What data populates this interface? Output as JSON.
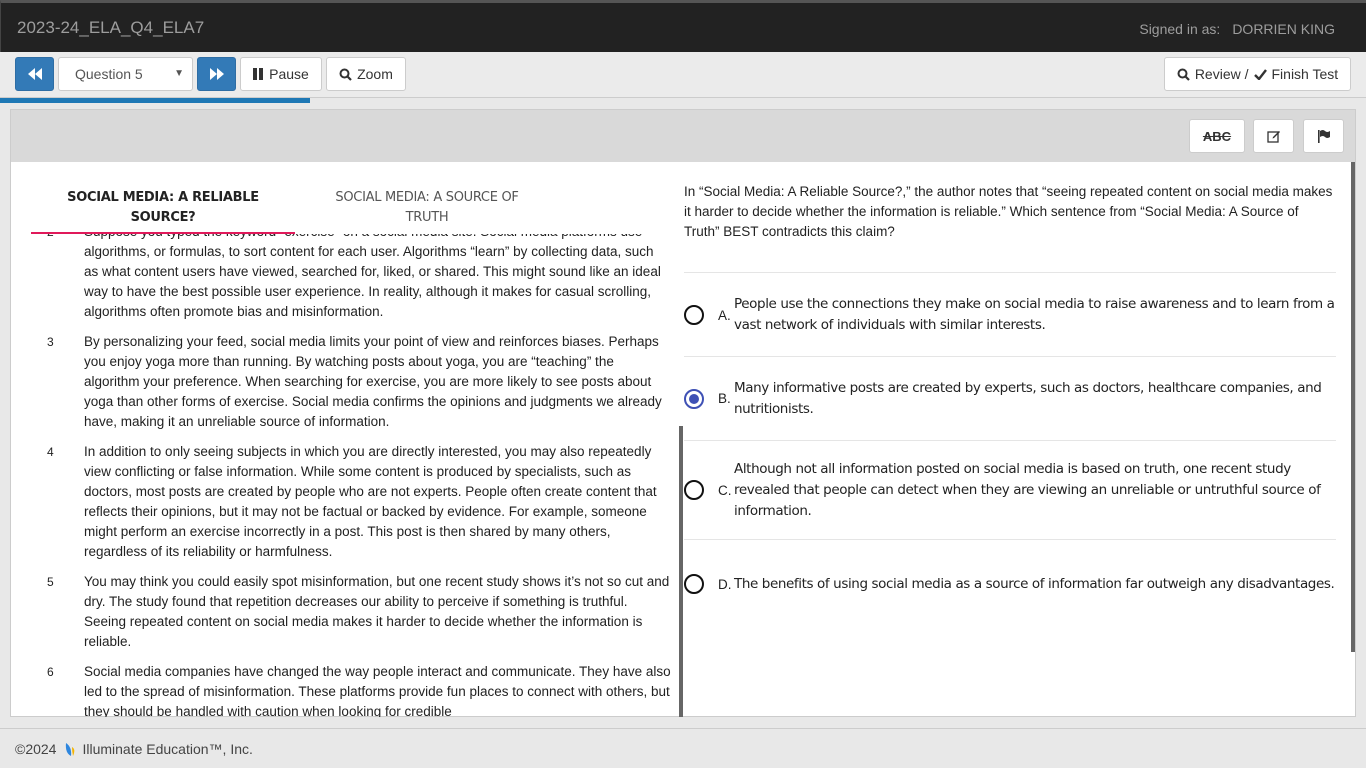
{
  "app": {
    "title": "2023-24_ELA_Q4_ELA7",
    "signed_in_label": "Signed in as:",
    "user_name": "DORRIEN KING"
  },
  "toolbar": {
    "prev_icon": "fast-backward-icon",
    "question_select": {
      "selected": "Question 5"
    },
    "next_icon": "fast-forward-icon",
    "pause_label": "Pause",
    "zoom_label": "Zoom",
    "review_label": "Review /",
    "finish_label": "Finish Test",
    "progress_percent": 22.7
  },
  "tools": {
    "strikethrough_label": "ABC",
    "notes_icon": "edit-icon",
    "flag_icon": "flag-icon"
  },
  "passage": {
    "tabs": [
      {
        "label": "SOCIAL MEDIA: A RELIABLE SOURCE?",
        "active": true
      },
      {
        "label": "SOCIAL MEDIA: A SOURCE OF TRUTH",
        "active": false
      }
    ],
    "paragraphs": [
      {
        "num": "2",
        "text": "Suppose you typed the keyword “exercise” on a social media site. Social media platforms use algorithms, or formulas, to sort content for each user. Algorithms “learn” by collecting data, such as what content users have viewed, searched for, liked, or shared. This might sound like an ideal way to have the best possible user experience. In reality, although it makes for casual scrolling, algorithms often promote bias and misinformation."
      },
      {
        "num": "3",
        "text": "By personalizing your feed, social media limits your point of view and reinforces biases. Perhaps you enjoy yoga more than running. By watching posts about yoga, you are “teaching” the algorithm your preference. When searching for exercise, you are more likely to see posts about yoga than other forms of exercise. Social media confirms the opinions and judgments we already have, making it an unreliable source of information."
      },
      {
        "num": "4",
        "text": "In addition to only seeing subjects in which you are directly interested, you may also repeatedly view conflicting or false information. While some content is produced by specialists, such as doctors, most posts are created by people who are not experts. People often create content that reflects their opinions, but it may not be factual or backed by evidence. For example, someone might perform an exercise incorrectly in a post. This post is then shared by many others, regardless of its reliability or harmfulness."
      },
      {
        "num": "5",
        "text": "You may think you could easily spot misinformation, but one recent study shows it’s not so cut and dry. The study found that repetition decreases our ability to perceive if something is truthful. Seeing repeated content on social media makes it harder to decide whether the information is reliable."
      },
      {
        "num": "6",
        "text": "Social media companies have changed the way people interact and communicate. They have also led to the spread of misinformation. These platforms provide fun places to connect with others, but they should be handled with caution when looking for credible"
      }
    ]
  },
  "question": {
    "stem": "In “Social Media: A Reliable Source?,” the author notes that “seeing repeated content on social media makes it harder to decide whether the information is reliable.” Which sentence from “Social Media: A Source of Truth” BEST contradicts this claim?",
    "choices": [
      {
        "letter": "A.",
        "text": "People use the connections they make on social media to raise awareness and to learn from a vast network of individuals with similar interests.",
        "selected": false
      },
      {
        "letter": "B.",
        "text": "Many informative posts are created by experts, such as doctors, healthcare companies, and nutritionists.",
        "selected": true
      },
      {
        "letter": "C.",
        "text": "Although not all information posted on social media is based on truth, one recent study revealed that people can detect when they are viewing an unreliable or untruthful source of information.",
        "selected": false
      },
      {
        "letter": "D.",
        "text": "The benefits of using social media as a source of information far outweigh any disadvantages.",
        "selected": false
      }
    ]
  },
  "footer": {
    "copyright": "©2024",
    "company": "Illuminate Education™, Inc.",
    "logo_icon": "illuminate-logo-icon"
  },
  "colors": {
    "primary": "#337ab7",
    "progress": "#1e78b5",
    "tab_accent": "#e0195a",
    "radio_selected": "#3f51b5",
    "topbar": "#222222"
  }
}
